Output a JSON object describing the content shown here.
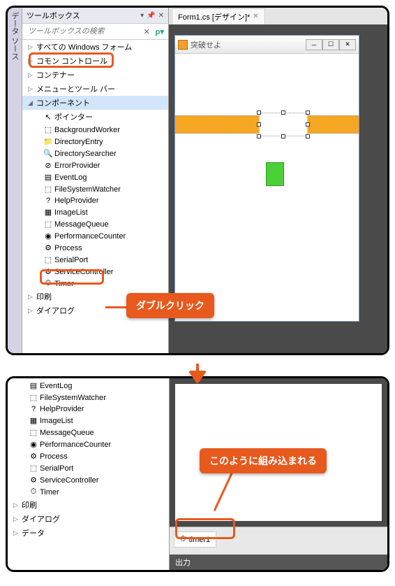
{
  "sidebar_tab": "データ ソース",
  "toolbox": {
    "title": "ツールボックス",
    "search_placeholder": "ツールボックスの検索",
    "categories": [
      {
        "label": "すべての Windows フォーム",
        "expanded": false
      },
      {
        "label": "コモン コントロール",
        "expanded": false
      },
      {
        "label": "コンテナー",
        "expanded": false
      },
      {
        "label": "メニューとツール バー",
        "expanded": false
      },
      {
        "label": "コンポーネント",
        "expanded": true
      },
      {
        "label": "印刷",
        "expanded": false
      },
      {
        "label": "ダイアログ",
        "expanded": false
      },
      {
        "label": "データ",
        "expanded": false
      }
    ],
    "components": [
      {
        "label": "ポインター",
        "icon": "pointer"
      },
      {
        "label": "BackgroundWorker",
        "icon": "bgworker"
      },
      {
        "label": "DirectoryEntry",
        "icon": "direntry"
      },
      {
        "label": "DirectorySearcher",
        "icon": "dirsearch"
      },
      {
        "label": "ErrorProvider",
        "icon": "error"
      },
      {
        "label": "EventLog",
        "icon": "eventlog"
      },
      {
        "label": "FileSystemWatcher",
        "icon": "fswatch"
      },
      {
        "label": "HelpProvider",
        "icon": "help"
      },
      {
        "label": "ImageList",
        "icon": "imglist"
      },
      {
        "label": "MessageQueue",
        "icon": "msgq"
      },
      {
        "label": "PerformanceCounter",
        "icon": "perf"
      },
      {
        "label": "Process",
        "icon": "process"
      },
      {
        "label": "SerialPort",
        "icon": "serial"
      },
      {
        "label": "ServiceController",
        "icon": "service"
      },
      {
        "label": "Timer",
        "icon": "timer"
      }
    ]
  },
  "designer": {
    "tab_label": "Form1.cs [デザイン]*",
    "form_title": "突破せよ",
    "tray_item": "timer1",
    "output_label": "出力"
  },
  "callouts": {
    "double_click": "ダブルクリック",
    "embedded": "このように組み込まれる"
  },
  "panel2_visible_start": "EventLog"
}
